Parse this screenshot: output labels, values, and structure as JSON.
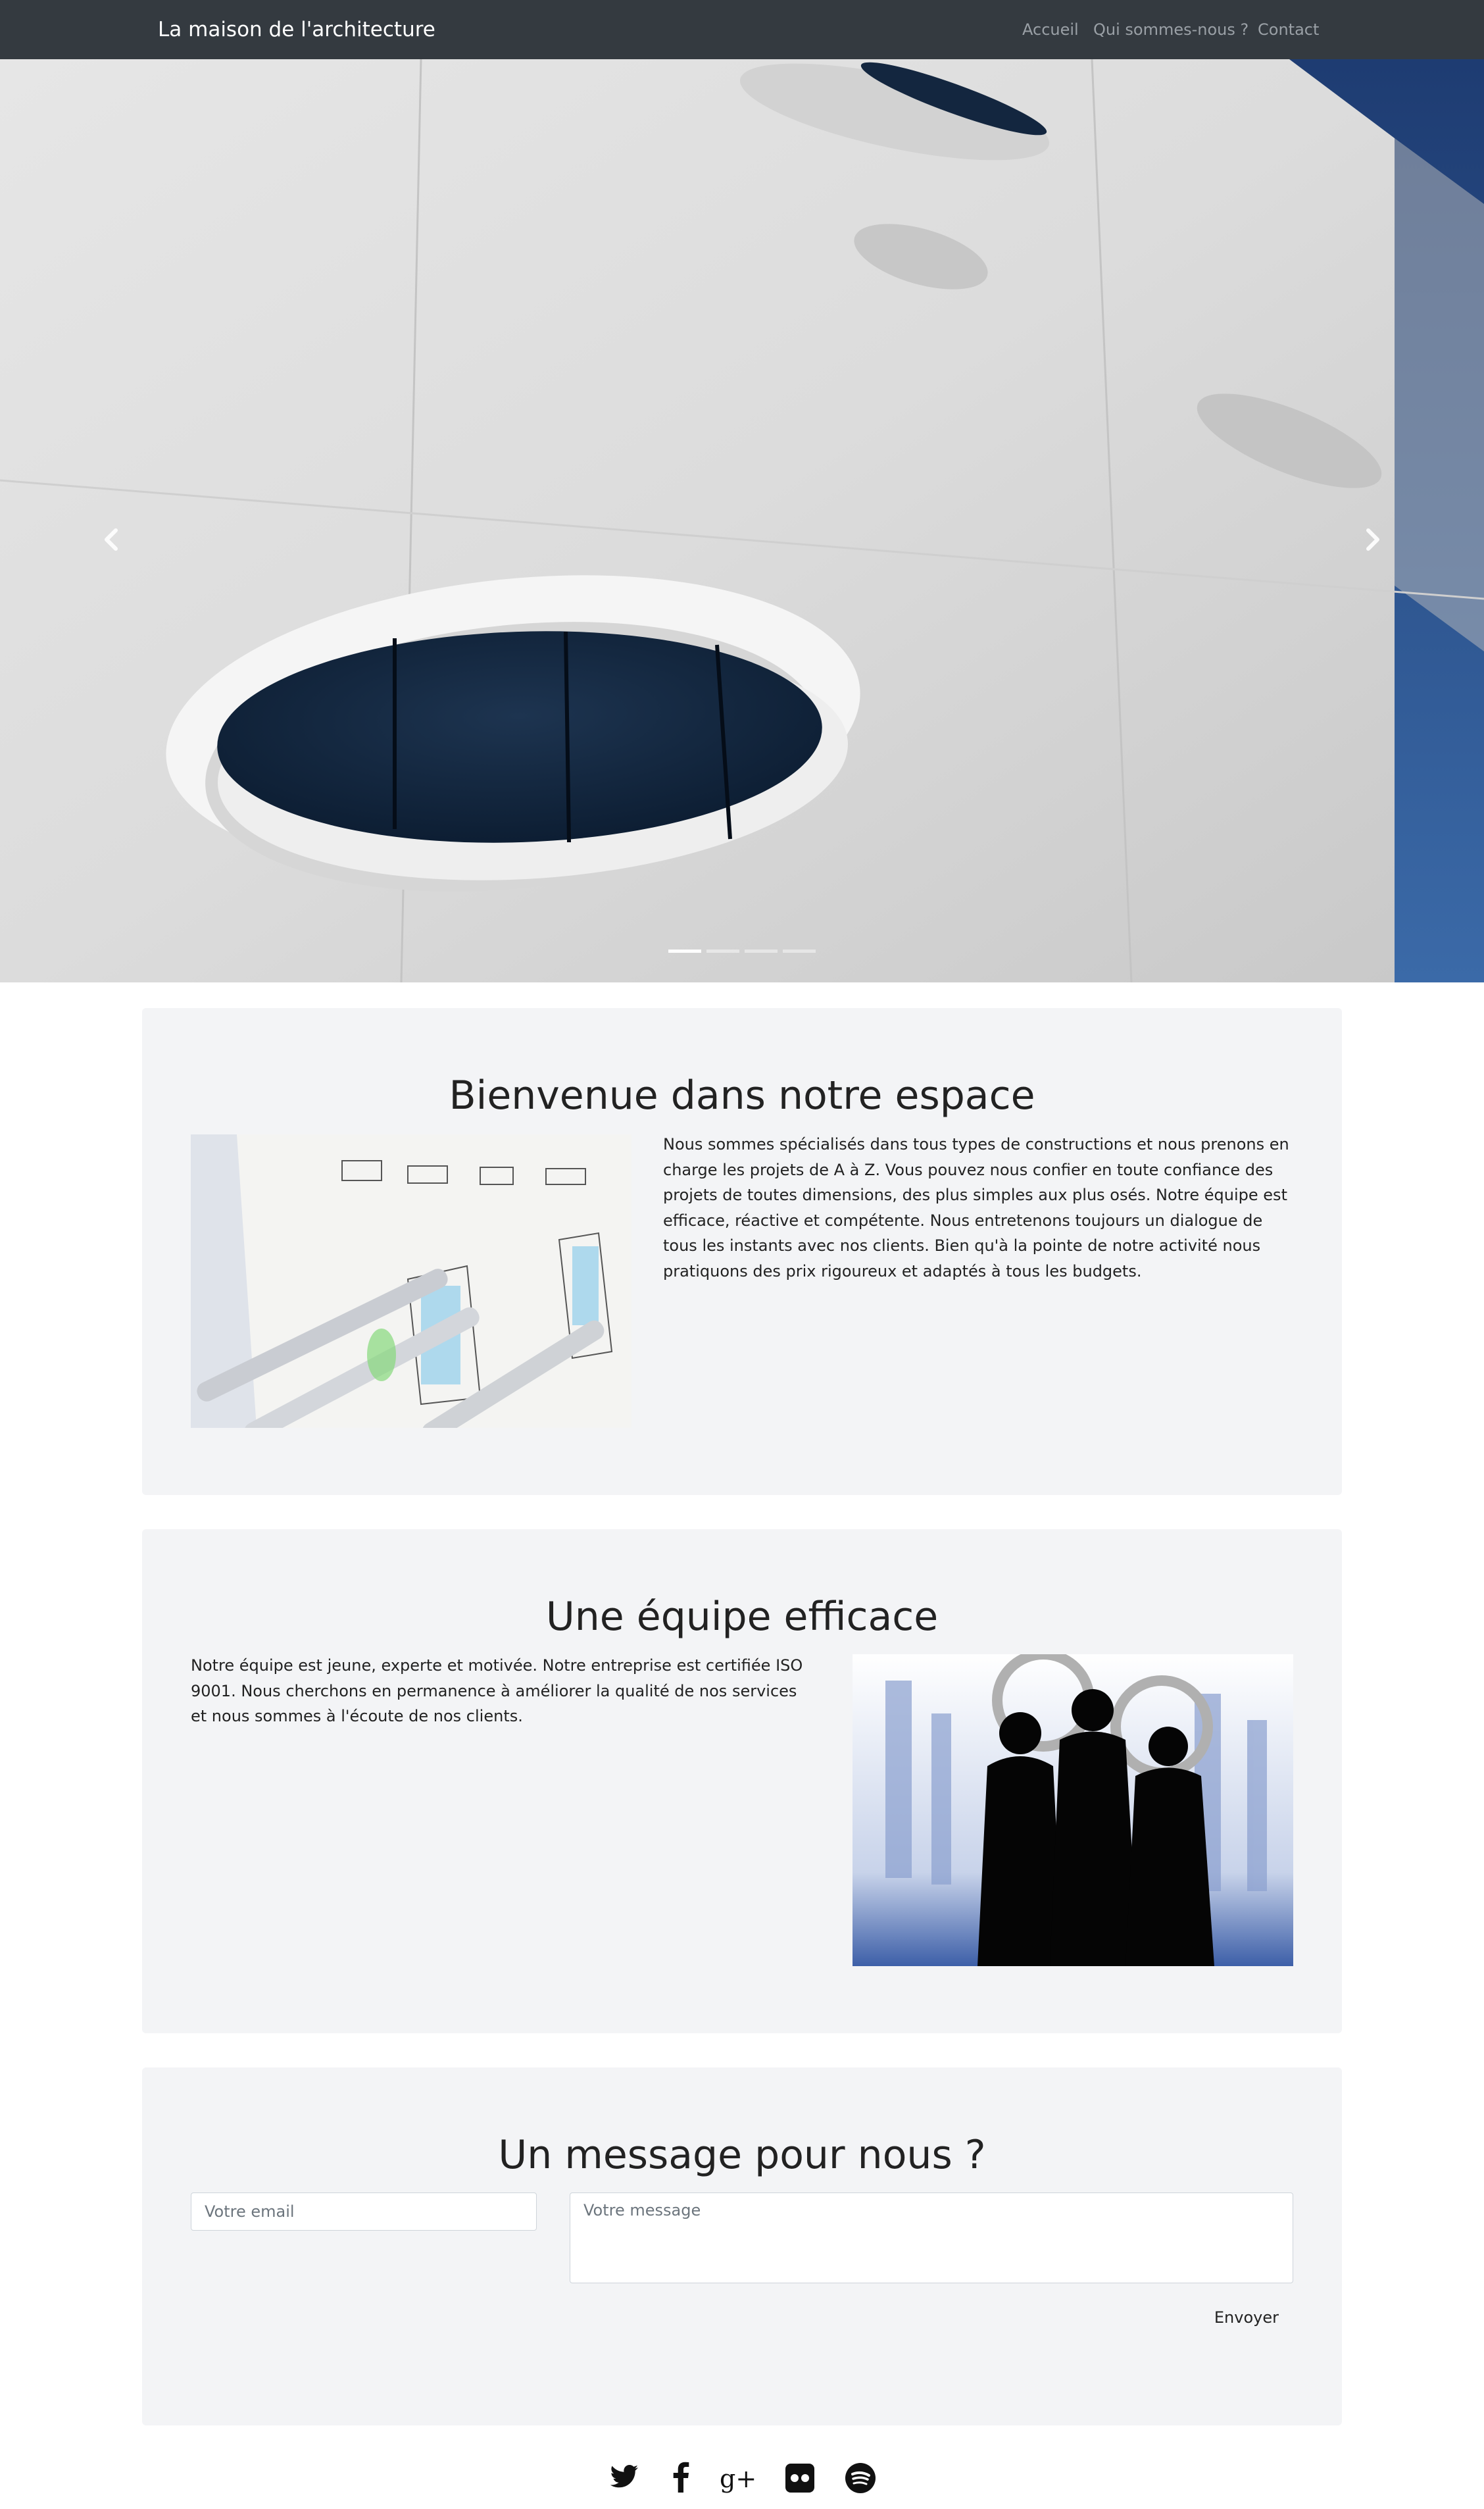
{
  "navbar": {
    "brand": "La maison de l'architecture",
    "links": [
      "Accueil",
      "Qui sommes-nous ?",
      "Contact"
    ]
  },
  "carousel": {
    "prev_icon": "chevron-left-icon",
    "next_icon": "chevron-right-icon",
    "indicator_count": 4,
    "active_indicator": 1
  },
  "welcome": {
    "title": "Bienvenue dans notre espace",
    "text": "Nous sommes spécialisés dans tous types de constructions et nous prenons en charge les projets de A à Z. Vous pouvez nous confier en toute confiance des projets de toutes dimensions, des plus simples aux plus osés. Notre équipe est efficace, réactive et compétente. Nous entretenons toujours un dialogue de tous les instants avec nos clients. Bien qu'à la pointe de notre activité nous pratiquons des prix rigoureux et adaptés à tous les budgets."
  },
  "team": {
    "title": "Une équipe efficace",
    "text": "Notre équipe est jeune, experte et motivée. Notre entreprise est certifiée ISO 9001. Nous cherchons en permanence à améliorer la qualité de nos services et nous sommes à l'écoute de nos clients."
  },
  "contact": {
    "title": "Un message pour nous ?",
    "email_placeholder": "Votre email",
    "message_placeholder": "Votre message",
    "send_label": "Envoyer"
  },
  "footer": {
    "social_icons": [
      "twitter-icon",
      "facebook-icon",
      "google-plus-icon",
      "flickr-icon",
      "spotify-icon"
    ]
  },
  "colors": {
    "navbar_bg": "#343a40",
    "section_bg": "#f3f4f6",
    "nav_link": "#9aa0a6"
  }
}
